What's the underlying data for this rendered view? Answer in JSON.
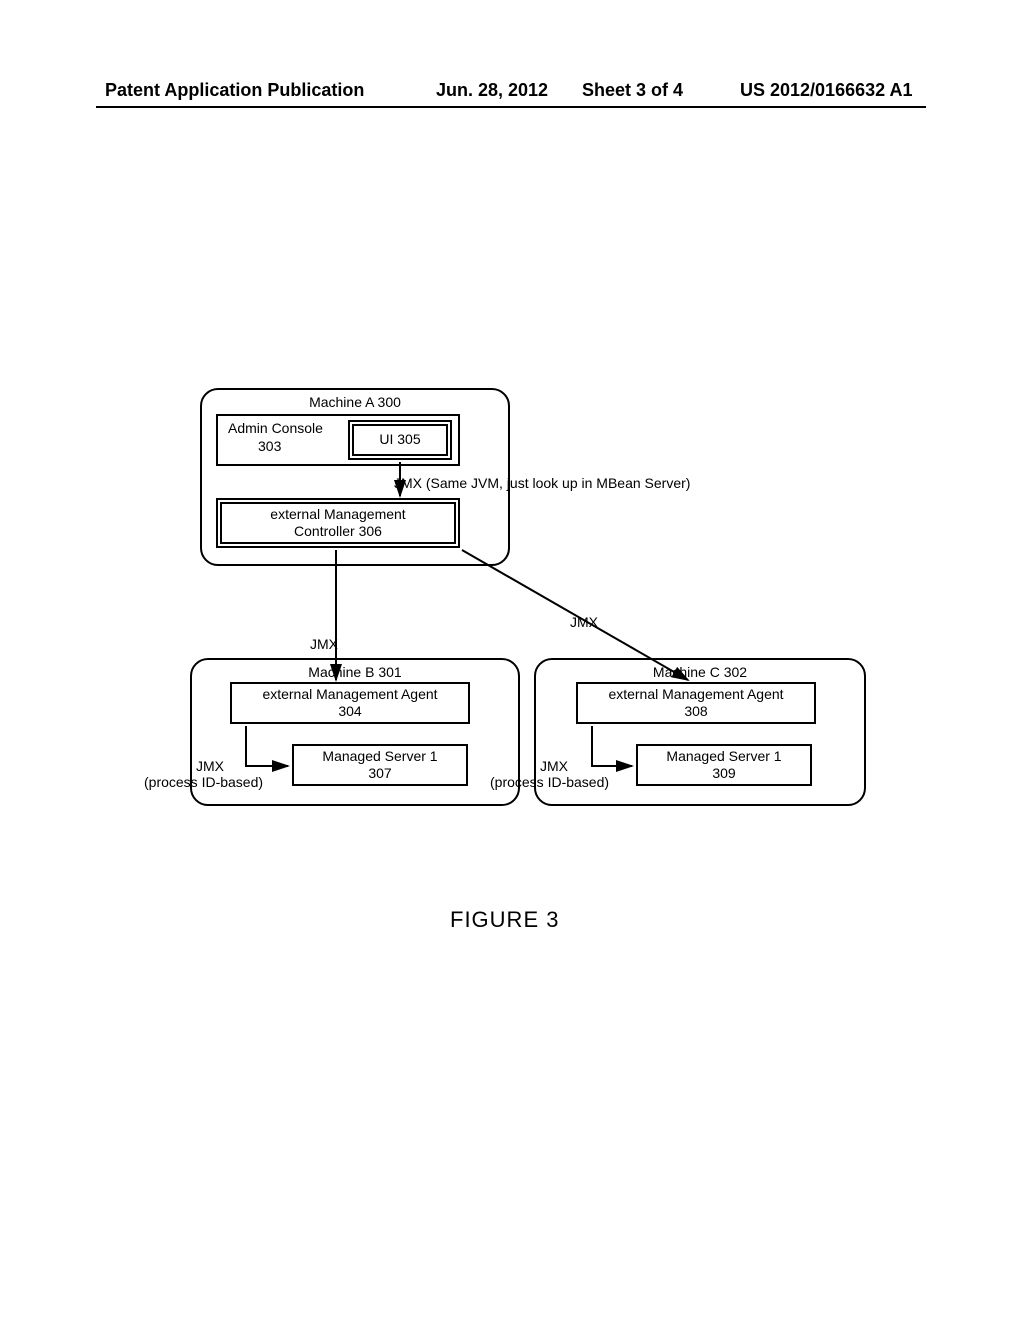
{
  "header": {
    "publication_label": "Patent Application Publication",
    "date": "Jun. 28, 2012",
    "sheet": "Sheet 3 of 4",
    "pub_number": "US 2012/0166632 A1"
  },
  "machine_a": {
    "title": "Machine A 300",
    "admin_console": "Admin Console",
    "admin_console_ref": "303",
    "ui": "UI 305",
    "ext_mgmt_ctrl_line1": "external Management",
    "ext_mgmt_ctrl_line2": "Controller 306"
  },
  "machine_b": {
    "title": "Machine B 301",
    "agent_line1": "external Management Agent",
    "agent_line2": "304",
    "server_line1": "Managed Server 1",
    "server_line2": "307"
  },
  "machine_c": {
    "title": "Machine C 302",
    "agent_line1": "external Management Agent",
    "agent_line2": "308",
    "server_line1": "Managed Server 1",
    "server_line2": "309"
  },
  "labels": {
    "jmx_same_jvm": "JMX (Same JVM, just look up in MBean Server)",
    "jmx_b": "JMX",
    "jmx_c": "JMX",
    "jmx_proc_b_line1": "JMX",
    "jmx_proc_b_line2": "(process ID-based)",
    "jmx_proc_c_line1": "JMX",
    "jmx_proc_c_line2": "(process ID-based)"
  },
  "figure": "FIGURE 3"
}
